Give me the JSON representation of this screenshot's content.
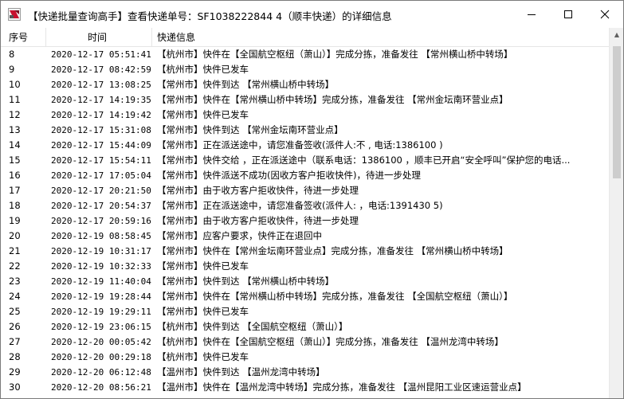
{
  "window": {
    "title": "【快递批量查询高手】查看快递单号：SF10382228​44  4（顺丰快递）的详细信息",
    "controls": {
      "minimize": "—",
      "maximize": "☐",
      "close": "✕"
    }
  },
  "table": {
    "headers": {
      "index": "序号",
      "time": "时间",
      "info": "快递信息"
    },
    "rows": [
      {
        "index": "8",
        "time": "2020-12-17 05:51:41",
        "info": "【杭州市】快件在【全国航空枢纽（萧山）】完成分拣，准备发往 【常州横山桥中转场】"
      },
      {
        "index": "9",
        "time": "2020-12-17 08:42:59",
        "info": "【杭州市】快件已发车"
      },
      {
        "index": "10",
        "time": "2020-12-17 13:08:25",
        "info": "【常州市】快件到达 【常州横山桥中转场】"
      },
      {
        "index": "11",
        "time": "2020-12-17 14:19:35",
        "info": "【常州市】快件在【常州横山桥中转场】完成分拣，准备发往 【常州金坛南环营业点】"
      },
      {
        "index": "12",
        "time": "2020-12-17 14:19:42",
        "info": "【常州市】快件已发车"
      },
      {
        "index": "13",
        "time": "2020-12-17 15:31:08",
        "info": "【常州市】快件到达 【常州金坛南环营业点】"
      },
      {
        "index": "14",
        "time": "2020-12-17 15:44:09",
        "info": "【常州市】正在派送途中，请您准备签收(派件人:不   , 电话:1386100    )"
      },
      {
        "index": "15",
        "time": "2020-12-17 15:54:11",
        "info": "【常州市】快件交给    ，正在派送途中（联系电话：1386100     ，顺丰已开启“安全呼叫”保护您的电话..."
      },
      {
        "index": "16",
        "time": "2020-12-17 17:05:04",
        "info": "【常州市】快件派送不成功(因收方客户拒收快件)，待进一步处理"
      },
      {
        "index": "17",
        "time": "2020-12-17 20:21:50",
        "info": "【常州市】由于收方客户拒收快件，待进一步处理"
      },
      {
        "index": "18",
        "time": "2020-12-17 20:54:37",
        "info": "【常州市】正在派送途中，请您准备签收(派件人:    ，电话:1391430    5)"
      },
      {
        "index": "19",
        "time": "2020-12-17 20:59:16",
        "info": "【常州市】由于收方客户拒收快件，待进一步处理"
      },
      {
        "index": "20",
        "time": "2020-12-19 08:58:45",
        "info": "【常州市】应客户要求，快件正在退回中"
      },
      {
        "index": "21",
        "time": "2020-12-19 10:31:17",
        "info": "【常州市】快件在【常州金坛南环营业点】完成分拣，准备发往 【常州横山桥中转场】"
      },
      {
        "index": "22",
        "time": "2020-12-19 10:32:33",
        "info": "【常州市】快件已发车"
      },
      {
        "index": "23",
        "time": "2020-12-19 11:40:04",
        "info": "【常州市】快件到达 【常州横山桥中转场】"
      },
      {
        "index": "24",
        "time": "2020-12-19 19:28:44",
        "info": "【常州市】快件在【常州横山桥中转场】完成分拣，准备发往 【全国航空枢纽（萧山）】"
      },
      {
        "index": "25",
        "time": "2020-12-19 19:29:11",
        "info": "【常州市】快件已发车"
      },
      {
        "index": "26",
        "time": "2020-12-19 23:06:15",
        "info": "【杭州市】快件到达 【全国航空枢纽（萧山）】"
      },
      {
        "index": "27",
        "time": "2020-12-20 00:05:42",
        "info": "【杭州市】快件在【全国航空枢纽（萧山）】完成分拣，准备发往 【温州龙湾中转场】"
      },
      {
        "index": "28",
        "time": "2020-12-20 00:29:18",
        "info": "【杭州市】快件已发车"
      },
      {
        "index": "29",
        "time": "2020-12-20 06:12:48",
        "info": "【温州市】快件到达 【温州龙湾中转场】"
      },
      {
        "index": "30",
        "time": "2020-12-20 08:56:21",
        "info": "【温州市】快件在【温州龙湾中转场】完成分拣，准备发往 【温州昆阳工业区速运营业点】"
      }
    ]
  },
  "scrollbar": {
    "up_arrow": "▲"
  }
}
